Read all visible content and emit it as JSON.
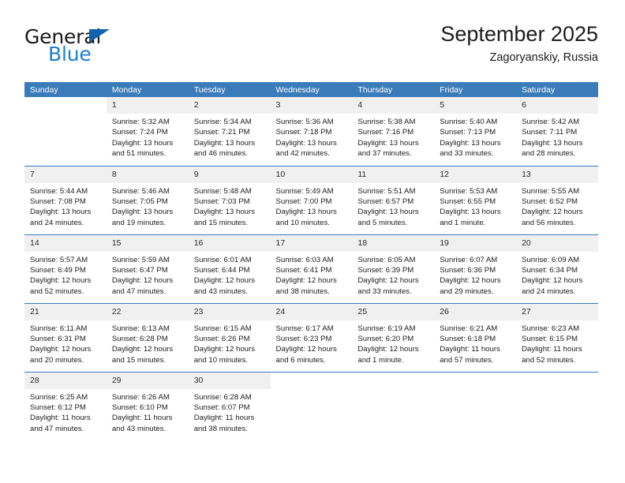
{
  "branding": {
    "logo_text_primary": "General",
    "logo_text_secondary": "Blue",
    "logo_triangle_color": "#1263ad",
    "logo_blue_color": "#1f7fd0"
  },
  "header": {
    "title": "September 2025",
    "subtitle": "Zagoryanskiy, Russia"
  },
  "theme": {
    "header_row_bg": "#3a7cba",
    "header_row_text": "#ffffff",
    "daynum_bg": "#f0f0f0",
    "week_divider": "#3a7cba",
    "page_bg": "#ffffff"
  },
  "weekday_headers": [
    "Sunday",
    "Monday",
    "Tuesday",
    "Wednesday",
    "Thursday",
    "Friday",
    "Saturday"
  ],
  "weeks": [
    [
      {
        "day": "",
        "blank": true,
        "sunrise": "",
        "sunset": "",
        "daylight_line1": "",
        "daylight_line2": ""
      },
      {
        "day": "1",
        "sunrise": "Sunrise: 5:32 AM",
        "sunset": "Sunset: 7:24 PM",
        "daylight_line1": "Daylight: 13 hours",
        "daylight_line2": "and 51 minutes."
      },
      {
        "day": "2",
        "sunrise": "Sunrise: 5:34 AM",
        "sunset": "Sunset: 7:21 PM",
        "daylight_line1": "Daylight: 13 hours",
        "daylight_line2": "and 46 minutes."
      },
      {
        "day": "3",
        "sunrise": "Sunrise: 5:36 AM",
        "sunset": "Sunset: 7:18 PM",
        "daylight_line1": "Daylight: 13 hours",
        "daylight_line2": "and 42 minutes."
      },
      {
        "day": "4",
        "sunrise": "Sunrise: 5:38 AM",
        "sunset": "Sunset: 7:16 PM",
        "daylight_line1": "Daylight: 13 hours",
        "daylight_line2": "and 37 minutes."
      },
      {
        "day": "5",
        "sunrise": "Sunrise: 5:40 AM",
        "sunset": "Sunset: 7:13 PM",
        "daylight_line1": "Daylight: 13 hours",
        "daylight_line2": "and 33 minutes."
      },
      {
        "day": "6",
        "sunrise": "Sunrise: 5:42 AM",
        "sunset": "Sunset: 7:11 PM",
        "daylight_line1": "Daylight: 13 hours",
        "daylight_line2": "and 28 minutes."
      }
    ],
    [
      {
        "day": "7",
        "sunrise": "Sunrise: 5:44 AM",
        "sunset": "Sunset: 7:08 PM",
        "daylight_line1": "Daylight: 13 hours",
        "daylight_line2": "and 24 minutes."
      },
      {
        "day": "8",
        "sunrise": "Sunrise: 5:46 AM",
        "sunset": "Sunset: 7:05 PM",
        "daylight_line1": "Daylight: 13 hours",
        "daylight_line2": "and 19 minutes."
      },
      {
        "day": "9",
        "sunrise": "Sunrise: 5:48 AM",
        "sunset": "Sunset: 7:03 PM",
        "daylight_line1": "Daylight: 13 hours",
        "daylight_line2": "and 15 minutes."
      },
      {
        "day": "10",
        "sunrise": "Sunrise: 5:49 AM",
        "sunset": "Sunset: 7:00 PM",
        "daylight_line1": "Daylight: 13 hours",
        "daylight_line2": "and 10 minutes."
      },
      {
        "day": "11",
        "sunrise": "Sunrise: 5:51 AM",
        "sunset": "Sunset: 6:57 PM",
        "daylight_line1": "Daylight: 13 hours",
        "daylight_line2": "and 5 minutes."
      },
      {
        "day": "12",
        "sunrise": "Sunrise: 5:53 AM",
        "sunset": "Sunset: 6:55 PM",
        "daylight_line1": "Daylight: 13 hours",
        "daylight_line2": "and 1 minute."
      },
      {
        "day": "13",
        "sunrise": "Sunrise: 5:55 AM",
        "sunset": "Sunset: 6:52 PM",
        "daylight_line1": "Daylight: 12 hours",
        "daylight_line2": "and 56 minutes."
      }
    ],
    [
      {
        "day": "14",
        "sunrise": "Sunrise: 5:57 AM",
        "sunset": "Sunset: 6:49 PM",
        "daylight_line1": "Daylight: 12 hours",
        "daylight_line2": "and 52 minutes."
      },
      {
        "day": "15",
        "sunrise": "Sunrise: 5:59 AM",
        "sunset": "Sunset: 6:47 PM",
        "daylight_line1": "Daylight: 12 hours",
        "daylight_line2": "and 47 minutes."
      },
      {
        "day": "16",
        "sunrise": "Sunrise: 6:01 AM",
        "sunset": "Sunset: 6:44 PM",
        "daylight_line1": "Daylight: 12 hours",
        "daylight_line2": "and 43 minutes."
      },
      {
        "day": "17",
        "sunrise": "Sunrise: 6:03 AM",
        "sunset": "Sunset: 6:41 PM",
        "daylight_line1": "Daylight: 12 hours",
        "daylight_line2": "and 38 minutes."
      },
      {
        "day": "18",
        "sunrise": "Sunrise: 6:05 AM",
        "sunset": "Sunset: 6:39 PM",
        "daylight_line1": "Daylight: 12 hours",
        "daylight_line2": "and 33 minutes."
      },
      {
        "day": "19",
        "sunrise": "Sunrise: 6:07 AM",
        "sunset": "Sunset: 6:36 PM",
        "daylight_line1": "Daylight: 12 hours",
        "daylight_line2": "and 29 minutes."
      },
      {
        "day": "20",
        "sunrise": "Sunrise: 6:09 AM",
        "sunset": "Sunset: 6:34 PM",
        "daylight_line1": "Daylight: 12 hours",
        "daylight_line2": "and 24 minutes."
      }
    ],
    [
      {
        "day": "21",
        "sunrise": "Sunrise: 6:11 AM",
        "sunset": "Sunset: 6:31 PM",
        "daylight_line1": "Daylight: 12 hours",
        "daylight_line2": "and 20 minutes."
      },
      {
        "day": "22",
        "sunrise": "Sunrise: 6:13 AM",
        "sunset": "Sunset: 6:28 PM",
        "daylight_line1": "Daylight: 12 hours",
        "daylight_line2": "and 15 minutes."
      },
      {
        "day": "23",
        "sunrise": "Sunrise: 6:15 AM",
        "sunset": "Sunset: 6:26 PM",
        "daylight_line1": "Daylight: 12 hours",
        "daylight_line2": "and 10 minutes."
      },
      {
        "day": "24",
        "sunrise": "Sunrise: 6:17 AM",
        "sunset": "Sunset: 6:23 PM",
        "daylight_line1": "Daylight: 12 hours",
        "daylight_line2": "and 6 minutes."
      },
      {
        "day": "25",
        "sunrise": "Sunrise: 6:19 AM",
        "sunset": "Sunset: 6:20 PM",
        "daylight_line1": "Daylight: 12 hours",
        "daylight_line2": "and 1 minute."
      },
      {
        "day": "26",
        "sunrise": "Sunrise: 6:21 AM",
        "sunset": "Sunset: 6:18 PM",
        "daylight_line1": "Daylight: 11 hours",
        "daylight_line2": "and 57 minutes."
      },
      {
        "day": "27",
        "sunrise": "Sunrise: 6:23 AM",
        "sunset": "Sunset: 6:15 PM",
        "daylight_line1": "Daylight: 11 hours",
        "daylight_line2": "and 52 minutes."
      }
    ],
    [
      {
        "day": "28",
        "sunrise": "Sunrise: 6:25 AM",
        "sunset": "Sunset: 6:12 PM",
        "daylight_line1": "Daylight: 11 hours",
        "daylight_line2": "and 47 minutes."
      },
      {
        "day": "29",
        "sunrise": "Sunrise: 6:26 AM",
        "sunset": "Sunset: 6:10 PM",
        "daylight_line1": "Daylight: 11 hours",
        "daylight_line2": "and 43 minutes."
      },
      {
        "day": "30",
        "sunrise": "Sunrise: 6:28 AM",
        "sunset": "Sunset: 6:07 PM",
        "daylight_line1": "Daylight: 11 hours",
        "daylight_line2": "and 38 minutes."
      },
      {
        "day": "",
        "blank": true,
        "sunrise": "",
        "sunset": "",
        "daylight_line1": "",
        "daylight_line2": ""
      },
      {
        "day": "",
        "blank": true,
        "sunrise": "",
        "sunset": "",
        "daylight_line1": "",
        "daylight_line2": ""
      },
      {
        "day": "",
        "blank": true,
        "sunrise": "",
        "sunset": "",
        "daylight_line1": "",
        "daylight_line2": ""
      },
      {
        "day": "",
        "blank": true,
        "sunrise": "",
        "sunset": "",
        "daylight_line1": "",
        "daylight_line2": ""
      }
    ]
  ]
}
